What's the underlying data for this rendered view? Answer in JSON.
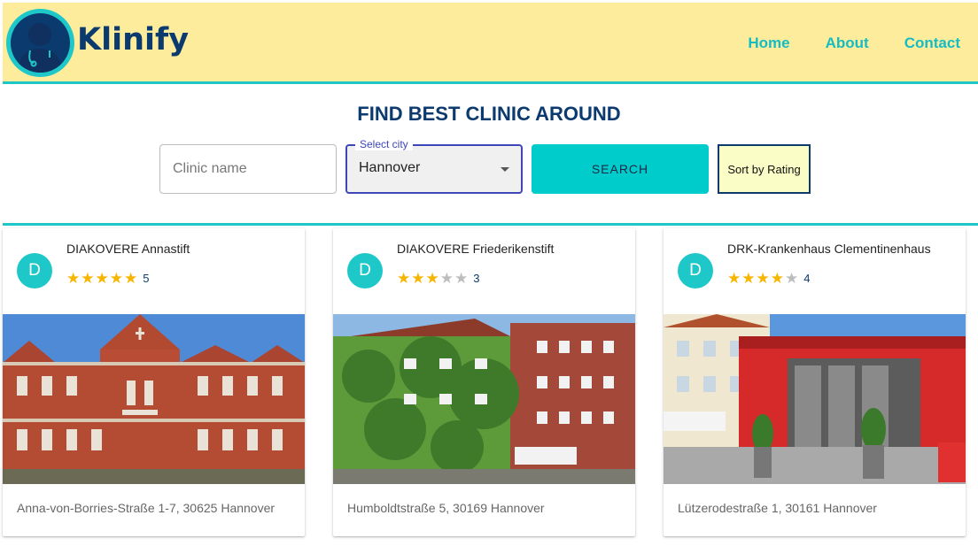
{
  "header": {
    "brand": "Klinify",
    "nav": [
      {
        "label": "Home"
      },
      {
        "label": "About"
      },
      {
        "label": "Contact"
      }
    ]
  },
  "search": {
    "title": "FIND BEST CLINIC AROUND",
    "clinic_placeholder": "Clinic name",
    "city_label": "Select city",
    "city_value": "Hannover",
    "search_label": "SEARCH",
    "sort_label": "Sort by Rating"
  },
  "colors": {
    "accent": "#20c6c6",
    "header_bg": "#fcec9c",
    "brand_navy": "#0b3a6e",
    "star": "#f7b500"
  },
  "clinics": [
    {
      "avatar": "D",
      "name": "DIAKOVERE Annastift",
      "rating": 5,
      "rating_label": "5",
      "image_desc": "red brick building",
      "address": "Anna-von-Borries-Straße 1-7, 30625 Hannover"
    },
    {
      "avatar": "D",
      "name": "DIAKOVERE Friederikenstift",
      "rating": 3,
      "rating_label": "3",
      "image_desc": "ivy covered brick building",
      "address": "Humboldtstraße 5, 30169 Hannover"
    },
    {
      "avatar": "D",
      "name": "DRK-Krankenhaus Clementinenhaus",
      "rating": 4,
      "rating_label": "4",
      "image_desc": "modern red entrance building",
      "address": "Lützerodestraße 1, 30161 Hannover"
    }
  ]
}
